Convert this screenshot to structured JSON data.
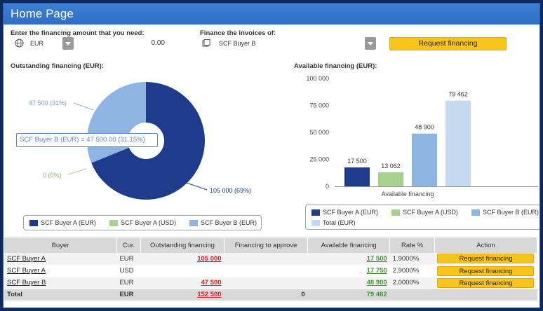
{
  "header": {
    "title": "Home Page"
  },
  "form": {
    "amount_label": "Enter the financing amount that you need:",
    "currency": "EUR",
    "amount_value": "0.00",
    "invoices_label": "Finance the invoices of:",
    "buyer": "SCF Buyer B",
    "request_button": "Request financing"
  },
  "outstanding": {
    "title": "Outstanding financing (EUR):",
    "tooltip": "SCF Buyer B (EUR) = 47 500.00 (31.15%)",
    "legend": [
      "SCF Buyer A (EUR)",
      "SCF Buyer A (USD)",
      "SCF Buyer B (EUR)"
    ]
  },
  "available": {
    "title": "Available financing (EUR):",
    "legend": [
      "SCF Buyer A (EUR)",
      "SCF Buyer A (USD)",
      "SCF Buyer B (EUR)",
      "Total (EUR)"
    ]
  },
  "colors": {
    "dark_blue": "#1f3b8c",
    "light_green": "#a9d18e",
    "mid_blue": "#8eb4e3",
    "pale_blue": "#c5d9f1",
    "button": "#f9c51a"
  },
  "chart_data": [
    {
      "type": "pie",
      "title": "Outstanding financing (EUR):",
      "categories": [
        "SCF Buyer A (EUR)",
        "SCF Buyer A (USD)",
        "SCF Buyer B (EUR)"
      ],
      "values": [
        105000,
        0,
        47500
      ],
      "data_labels": [
        "105 000 (69%)",
        "0 (0%)",
        "47 500 (31%)"
      ],
      "legend": "bottom"
    },
    {
      "type": "bar",
      "title": "Available financing (EUR):",
      "categories": [
        "Available financing"
      ],
      "series": [
        {
          "name": "SCF Buyer A (EUR)",
          "values": [
            17500
          ],
          "label": "17 500"
        },
        {
          "name": "SCF Buyer A (USD)",
          "values": [
            13062
          ],
          "label": "13 062"
        },
        {
          "name": "SCF Buyer B (EUR)",
          "values": [
            48900
          ],
          "label": "48 900"
        },
        {
          "name": "Total (EUR)",
          "values": [
            79462
          ],
          "label": "79 462"
        }
      ],
      "yticks": [
        "0",
        "25 000",
        "50 000",
        "75 000",
        "100 000"
      ],
      "ylim": [
        0,
        100000
      ],
      "xlabel": "Available financing",
      "legend": "bottom"
    }
  ],
  "table": {
    "headers": [
      "Buyer",
      "Cur.",
      "Outstanding financing",
      "Financing to approve",
      "Available financing",
      "Rate %",
      "Action"
    ],
    "rows": [
      {
        "buyer": "SCF Buyer A",
        "cur": "EUR",
        "outstanding": "105 000",
        "approve": "",
        "available": "17 500",
        "rate": "1.9000%",
        "action": "Request financing"
      },
      {
        "buyer": "SCF Buyer A",
        "cur": "USD",
        "outstanding": "",
        "approve": "",
        "available": "17 750",
        "rate": "2.9000%",
        "action": "Request financing"
      },
      {
        "buyer": "SCF Buyer B",
        "cur": "EUR",
        "outstanding": "47 500",
        "approve": "",
        "available": "48 900",
        "rate": "2.0000%",
        "action": "Request financing"
      }
    ],
    "total": {
      "label": "Total",
      "cur": "EUR",
      "outstanding": "152 500",
      "approve": "0",
      "available": "79 462"
    }
  }
}
